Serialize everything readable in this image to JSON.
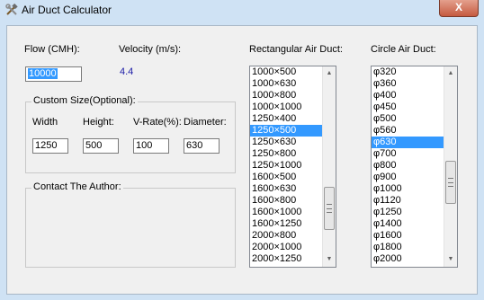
{
  "window": {
    "title": "Air Duct Calculator",
    "close_glyph": "X",
    "icon": "wrench-hammer-icon"
  },
  "flow": {
    "label": "Flow (CMH):",
    "value": "10000"
  },
  "velocity": {
    "label": "Velocity (m/s):",
    "value": "4.4"
  },
  "custom": {
    "title": "Custom Size(Optional):",
    "width_label": "Width",
    "width_value": "1250",
    "height_label": "Height:",
    "height_value": "500",
    "vrate_label": "V-Rate(%):",
    "vrate_value": "100",
    "diameter_label": "Diameter:",
    "diameter_value": "630"
  },
  "contact": {
    "title": "Contact The Author:"
  },
  "rect": {
    "label": "Rectangular Air Duct:",
    "items": [
      "1000×500",
      "1000×630",
      "1000×800",
      "1000×1000",
      "1250×400",
      "1250×500",
      "1250×630",
      "1250×800",
      "1250×1000",
      "1600×500",
      "1600×630",
      "1600×800",
      "1600×1000",
      "1600×1250",
      "2000×800",
      "2000×1000",
      "2000×1250"
    ],
    "selected_index": 5,
    "scroll_position": 0.82
  },
  "circle": {
    "label": "Circle Air Duct:",
    "items": [
      "φ320",
      "φ360",
      "φ400",
      "φ450",
      "φ500",
      "φ560",
      "φ630",
      "φ700",
      "φ800",
      "φ900",
      "φ1000",
      "φ1120",
      "φ1250",
      "φ1400",
      "φ1600",
      "φ1800",
      "φ2000"
    ],
    "selected_index": 6,
    "scroll_position": 0.62
  },
  "colors": {
    "selection": "#3399ff",
    "velocity_text": "#1a1aa6",
    "title_bg": "#cfe2f4"
  }
}
